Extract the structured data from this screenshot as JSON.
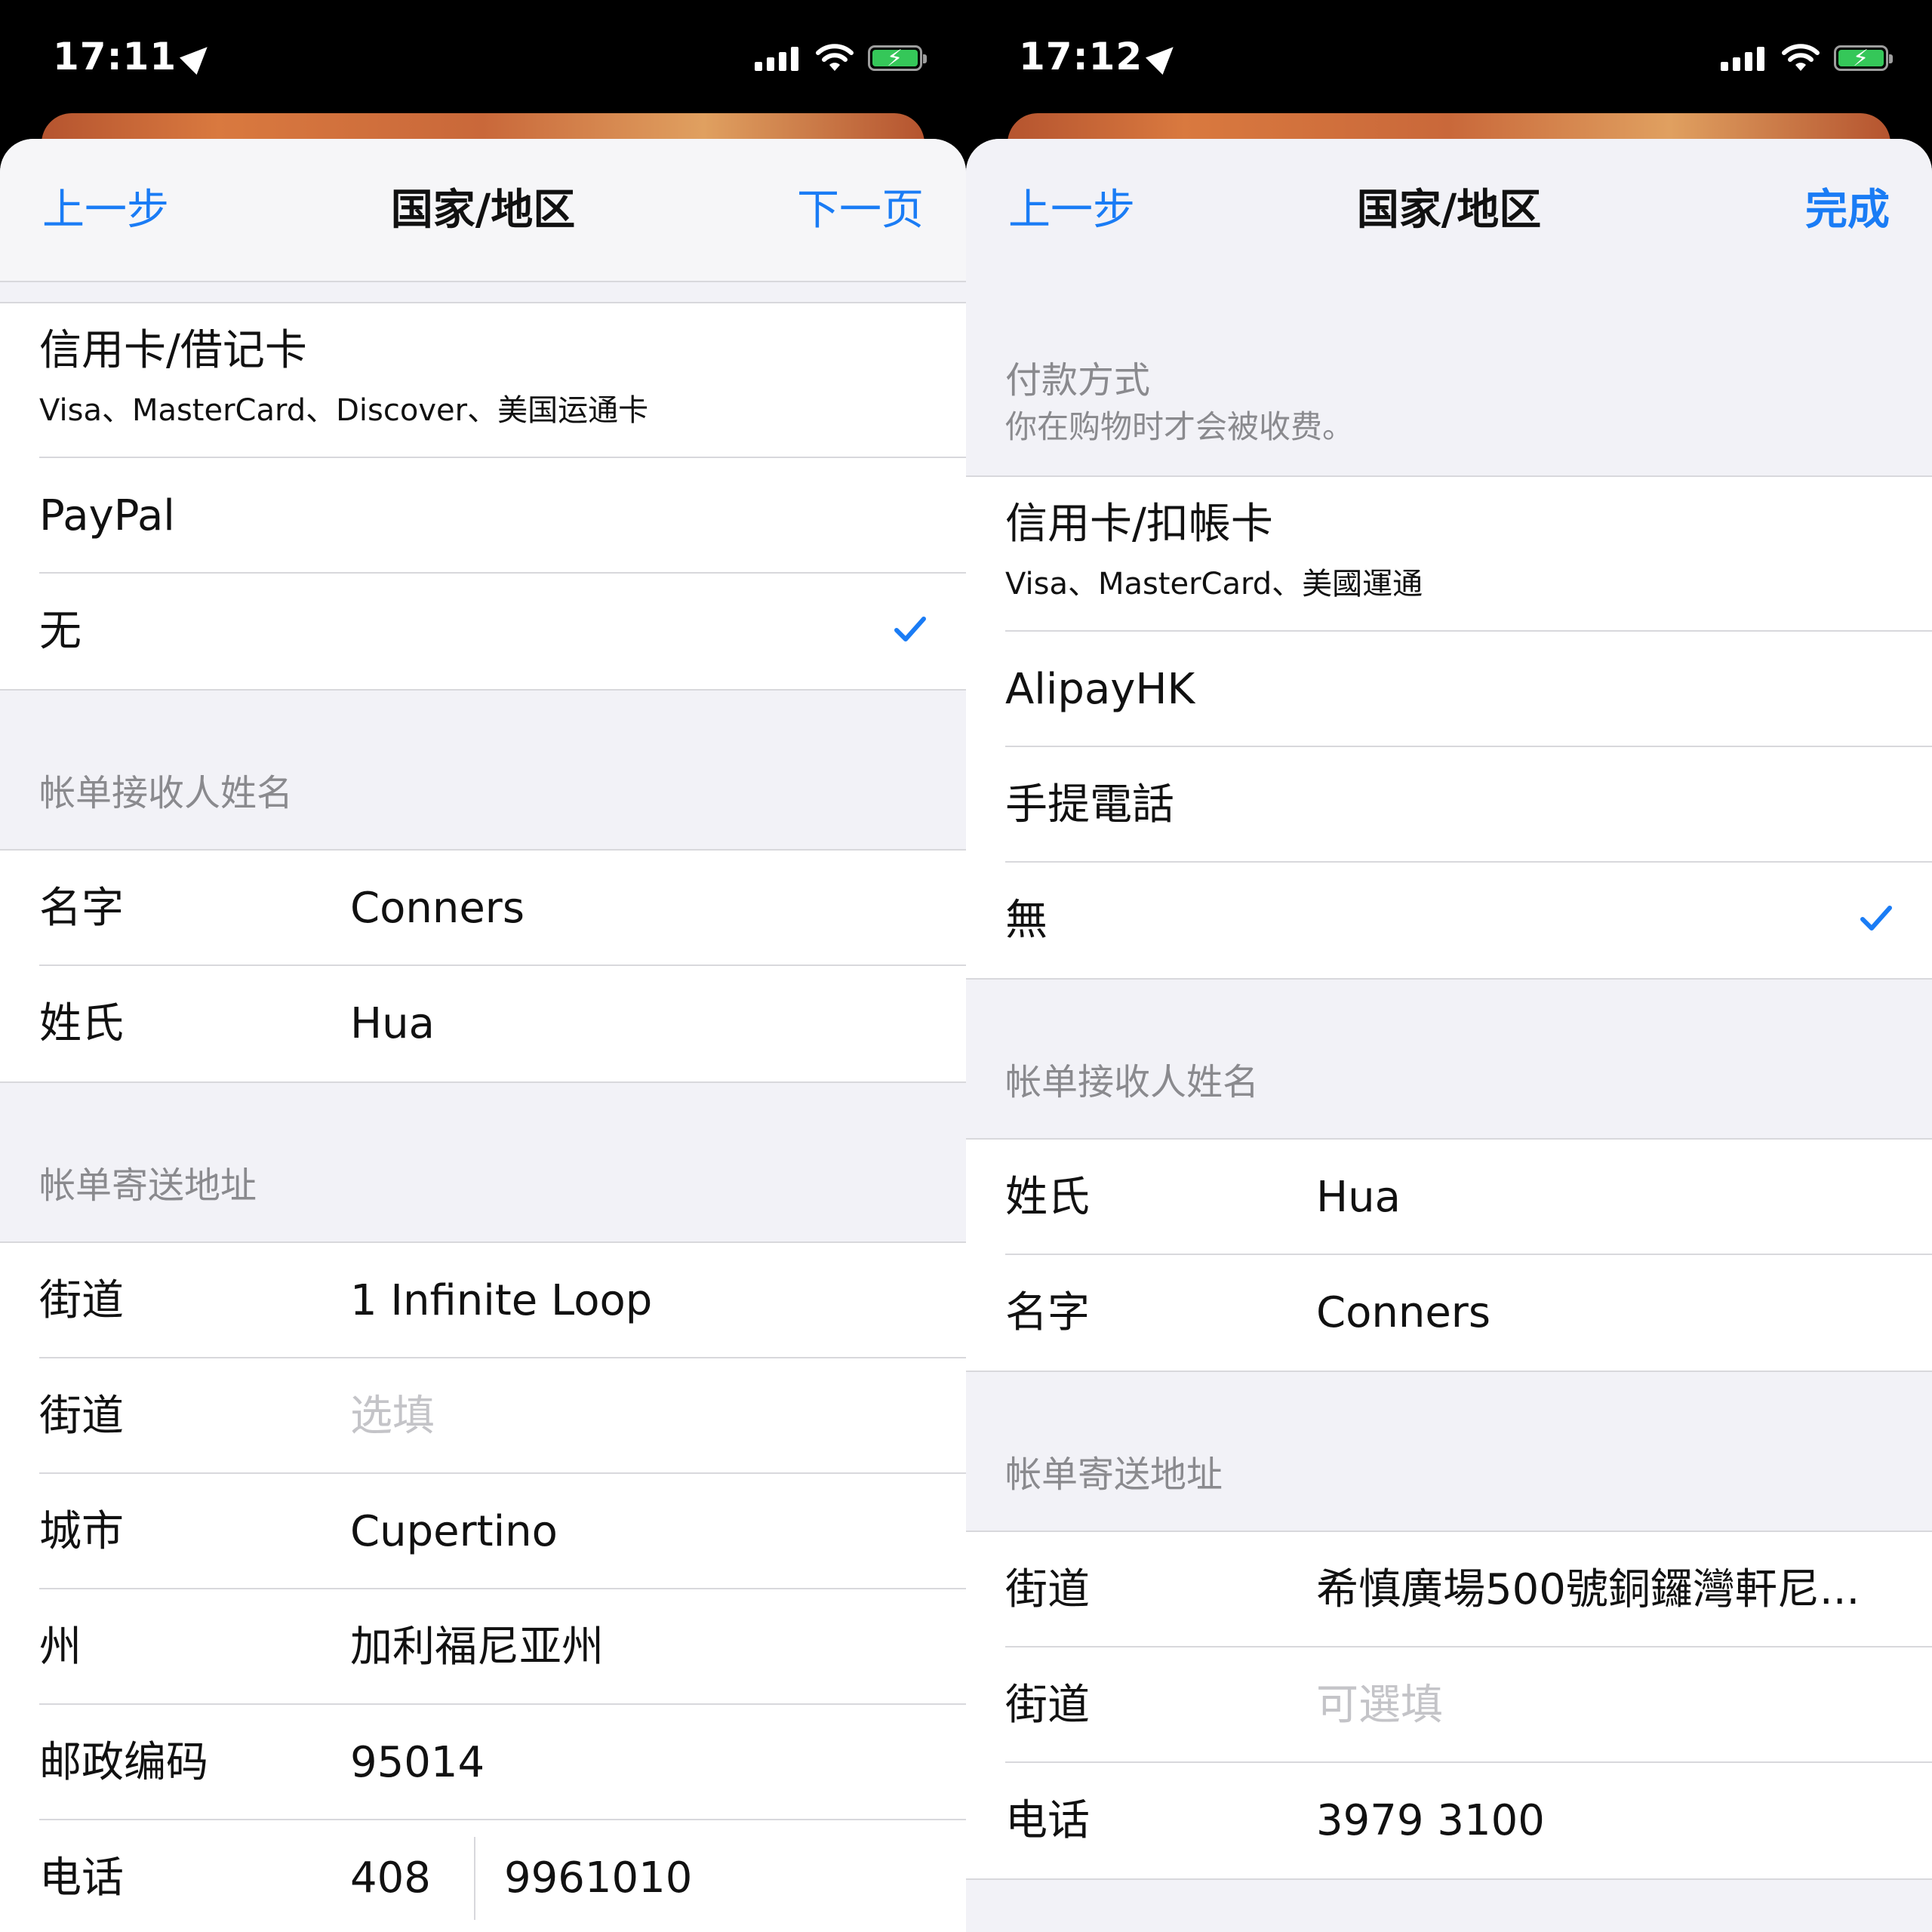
{
  "left": {
    "status": {
      "time": "17:11"
    },
    "nav": {
      "back": "上一步",
      "title": "国家/地区",
      "next": "下一页"
    },
    "payment": [
      {
        "title": "信用卡/借记卡",
        "subtitle": "Visa、MasterCard、Discover、美国运通卡"
      },
      {
        "title": "PayPal"
      },
      {
        "title": "无",
        "checked": true
      }
    ],
    "name_header": "帐单接收人姓名",
    "name_rows": [
      {
        "label": "名字",
        "value": "Conners"
      },
      {
        "label": "姓氏",
        "value": "Hua"
      }
    ],
    "address_header": "帐单寄送地址",
    "address_rows": [
      {
        "label": "街道",
        "value": "1 Infinite Loop"
      },
      {
        "label": "街道",
        "placeholder": "选填"
      },
      {
        "label": "城市",
        "value": "Cupertino"
      },
      {
        "label": "州",
        "value": "加利福尼亚州"
      },
      {
        "label": "邮政编码",
        "value": "95014"
      }
    ],
    "phone": {
      "label": "电话",
      "area": "408",
      "number": "9961010"
    }
  },
  "right": {
    "status": {
      "time": "17:12"
    },
    "nav": {
      "back": "上一步",
      "title": "国家/地区",
      "done": "完成"
    },
    "payment_header": {
      "title": "付款方式",
      "subtitle": "你在购物时才会被收费。"
    },
    "payment": [
      {
        "title": "信用卡/扣帳卡",
        "subtitle": "Visa、MasterCard、美國運通"
      },
      {
        "title": "AlipayHK"
      },
      {
        "title": "手提電話"
      },
      {
        "title": "無",
        "checked": true
      }
    ],
    "name_header": "帐单接收人姓名",
    "name_rows": [
      {
        "label": "姓氏",
        "value": "Hua"
      },
      {
        "label": "名字",
        "value": "Conners"
      }
    ],
    "address_header": "帐单寄送地址",
    "address_rows": [
      {
        "label": "街道",
        "value": "希慎廣場500號銅鑼灣軒尼..."
      },
      {
        "label": "街道",
        "placeholder": "可選填"
      },
      {
        "label": "电话",
        "value": "3979 3100"
      }
    ]
  },
  "colors": {
    "accent": "#1a7cf5",
    "check": "#1a7cf5",
    "battery": "#35c759"
  },
  "icons": [
    "location-arrow-icon",
    "signal-icon",
    "wifi-icon",
    "battery-charging-icon",
    "checkmark-icon"
  ]
}
